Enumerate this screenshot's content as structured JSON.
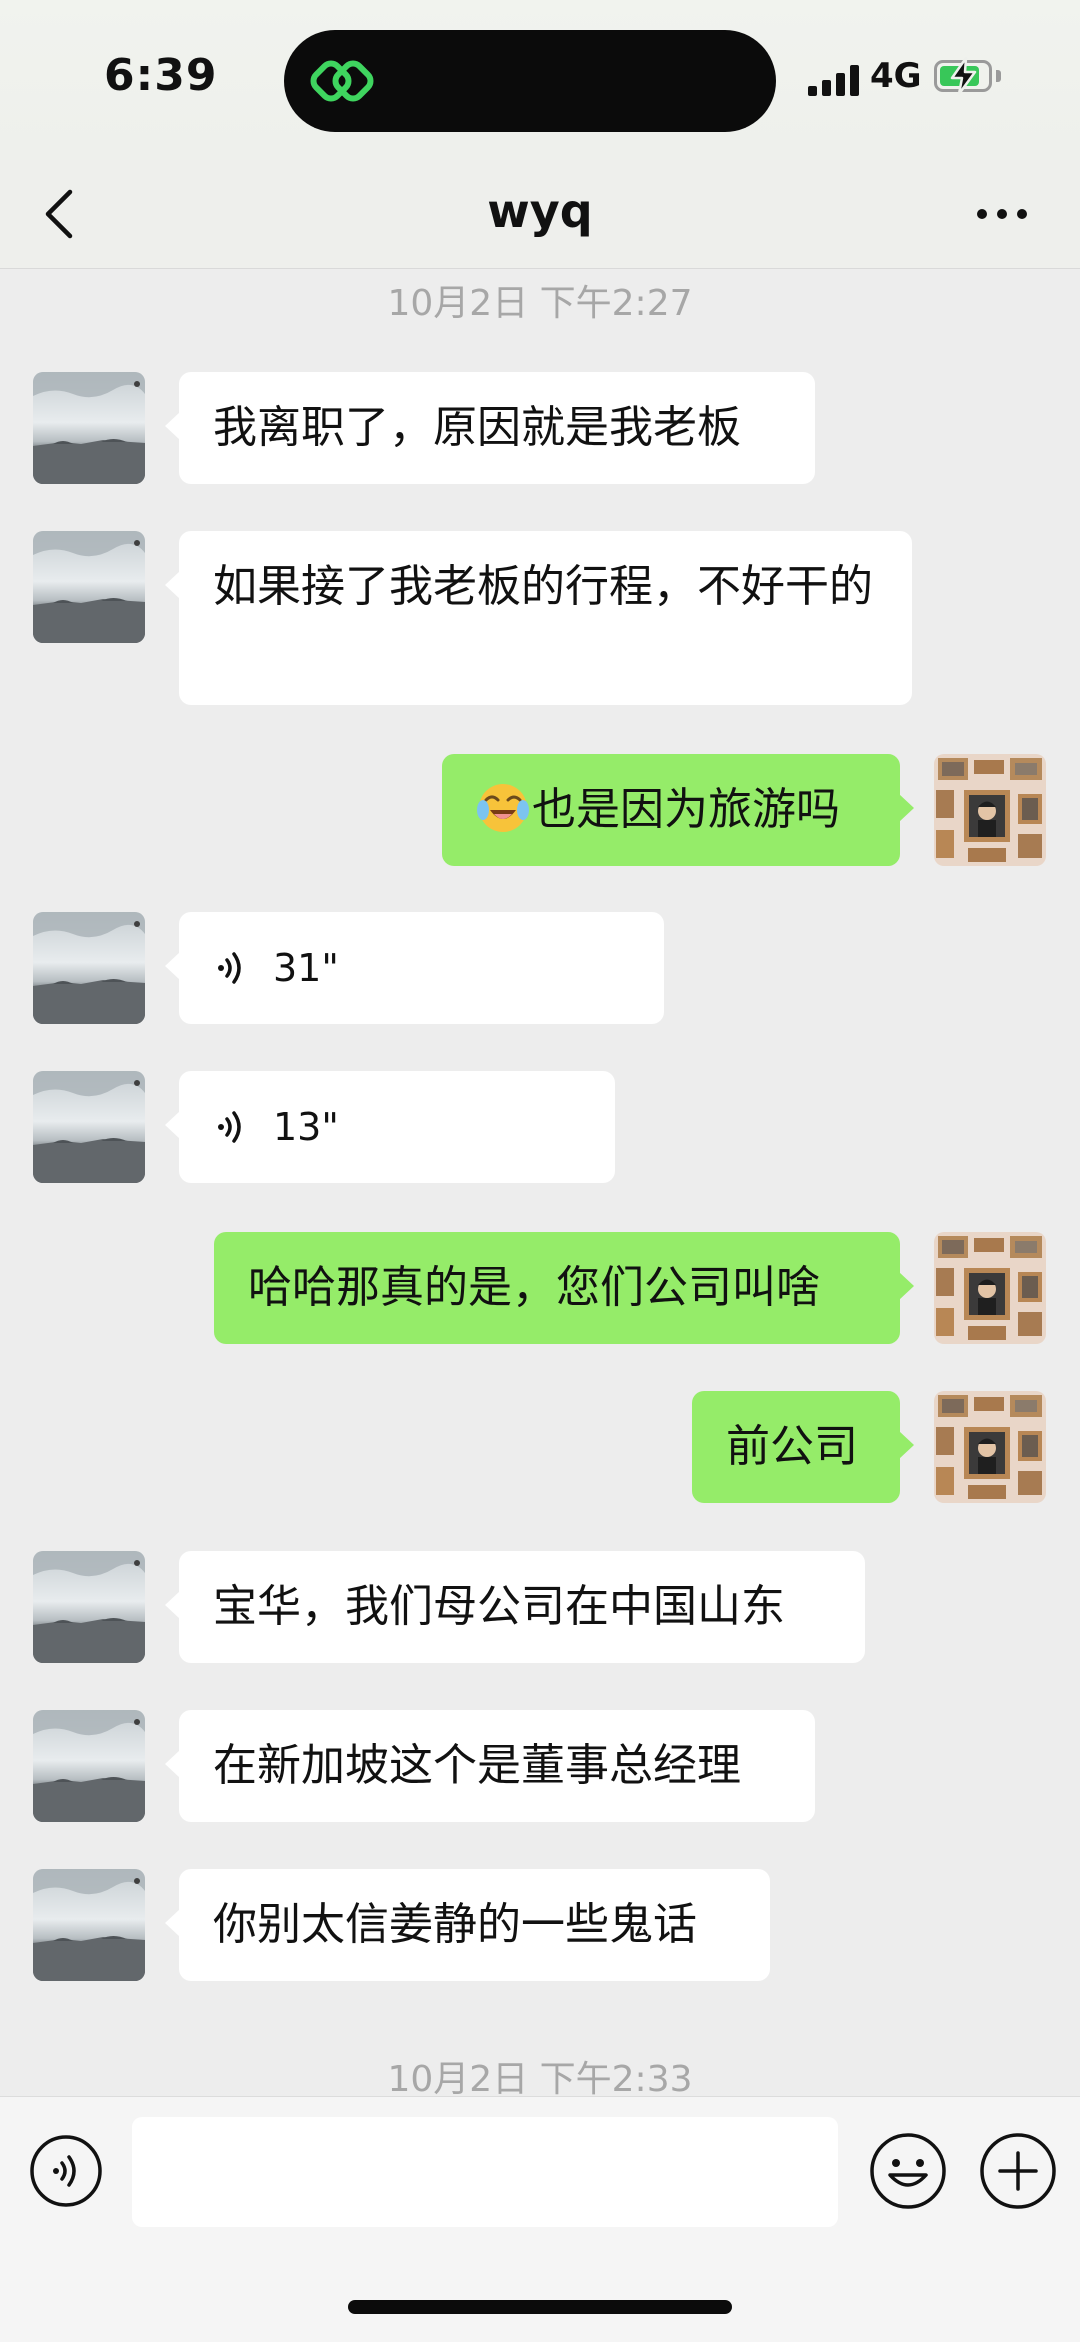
{
  "status_bar": {
    "time": "6:39",
    "network": "4G",
    "battery_level": 0.85,
    "battery_charging": true,
    "battery_color": "#38c759"
  },
  "header": {
    "title": "wyq",
    "back_icon": "chevron-left-icon",
    "more_icon": "ellipsis-icon"
  },
  "timestamps": [
    "10月2日 下午2:27",
    "10月2日 下午2:33"
  ],
  "messages": [
    {
      "side": "in",
      "type": "text",
      "text": "我离职了，原因就是我老板"
    },
    {
      "side": "in",
      "type": "text",
      "text": "如果接了我老板的行程，不好干的"
    },
    {
      "side": "out",
      "type": "text",
      "emoji": "crying-laughing-face",
      "text": "也是因为旅游吗"
    },
    {
      "side": "in",
      "type": "voice",
      "duration": "31\""
    },
    {
      "side": "in",
      "type": "voice",
      "duration": "13\""
    },
    {
      "side": "out",
      "type": "text",
      "text": "哈哈那真的是，您们公司叫啥"
    },
    {
      "side": "out",
      "type": "text",
      "text": "前公司"
    },
    {
      "side": "in",
      "type": "text",
      "text": "宝华，我们母公司在中国山东"
    },
    {
      "side": "in",
      "type": "text",
      "text": "在新加坡这个是董事总经理"
    },
    {
      "side": "in",
      "type": "text",
      "text": "你别太信姜静的一些鬼话"
    }
  ],
  "input_bar": {
    "message_value": "",
    "voice_icon": "voice-mode-icon",
    "emoji_icon": "smiley-icon",
    "plus_icon": "plus-circle-icon"
  },
  "colors": {
    "outgoing_bubble": "#95ec69",
    "incoming_bubble": "#ffffff",
    "background": "#ededed"
  }
}
